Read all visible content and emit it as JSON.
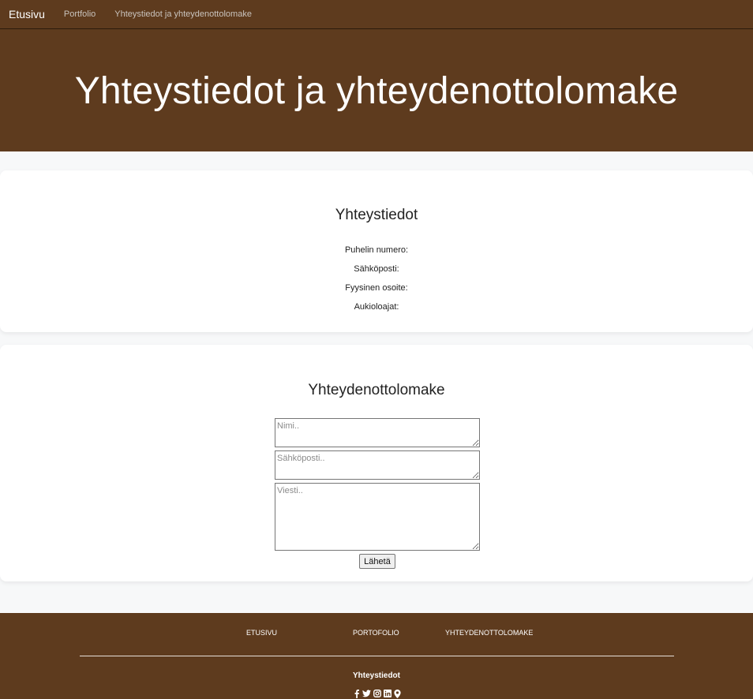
{
  "navbar": {
    "brand": "Etusivu",
    "links": [
      "Portfolio",
      "Yhteystiedot ja yhteydenottolomake"
    ]
  },
  "hero": {
    "title": "Yhteystiedot ja yhteydenottolomake"
  },
  "contact_info": {
    "title": "Yhteystiedot",
    "lines": [
      "Puhelin numero:",
      "Sähköposti:",
      "Fyysinen osoite:",
      "Aukioloajat:"
    ]
  },
  "contact_form": {
    "title": "Yhteydenottolomake",
    "name_placeholder": "Nimi..",
    "email_placeholder": "Sähköposti..",
    "message_placeholder": "Viesti..",
    "submit_label": "Lähetä"
  },
  "footer": {
    "links": [
      "ETUSIVU",
      "PORTOFOLIO",
      "YHTEYDENOTTOLOMAKE"
    ],
    "title": "Yhteystiedot",
    "social_icons": [
      "facebook-icon",
      "twitter-icon",
      "instagram-icon",
      "linkedin-icon",
      "map-marker-icon"
    ]
  },
  "colors": {
    "brand_brown": "#5e3b1e",
    "page_background": "#f7f8f9"
  }
}
